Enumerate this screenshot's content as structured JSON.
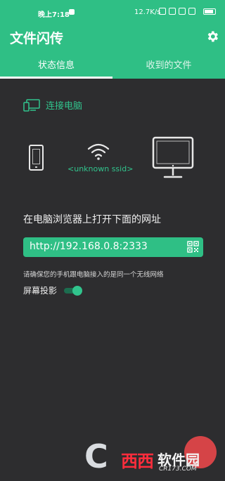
{
  "status_bar": {
    "time": "晚上7:18",
    "network_speed": "12.7K/s"
  },
  "app": {
    "title": "文件闪传"
  },
  "tabs": [
    {
      "label": "状态信息",
      "active": true
    },
    {
      "label": "收到的文件",
      "active": false
    }
  ],
  "connection": {
    "label": "连接电脑",
    "ssid": "<unknown ssid>"
  },
  "instruction": "在电脑浏览器上打开下面的网址",
  "url": "http://192.168.0.8:2333",
  "note": "请确保您的手机跟电脑接入的是同一个无线网络",
  "screen_projection": {
    "label": "屏幕投影",
    "enabled": true
  },
  "watermark": {
    "letter": "C",
    "brand": "西西",
    "brand2": "软件园",
    "domain": "CR173.COM"
  },
  "colors": {
    "accent": "#2fbf85",
    "background": "#2d2d2f",
    "accent_text": "#31c48d"
  }
}
